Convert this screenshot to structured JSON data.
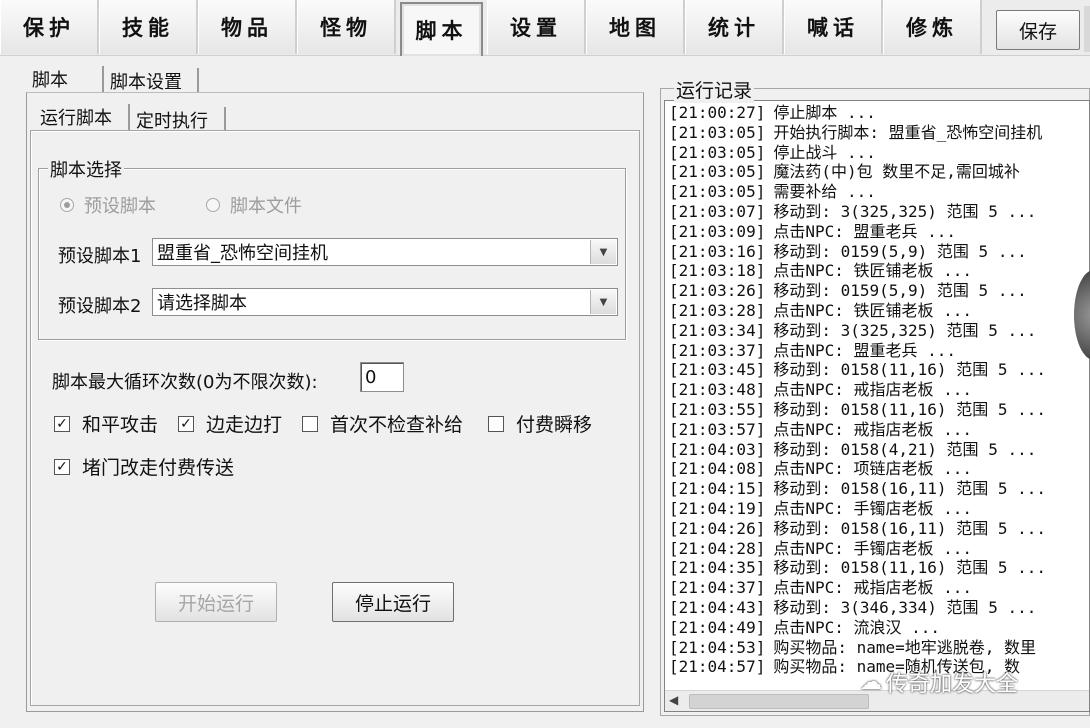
{
  "top_tabs": [
    {
      "label": "保护",
      "active": false
    },
    {
      "label": "技能",
      "active": false
    },
    {
      "label": "物品",
      "active": false
    },
    {
      "label": "怪物",
      "active": false
    },
    {
      "label": "脚本",
      "active": true
    },
    {
      "label": "设置",
      "active": false
    },
    {
      "label": "地图",
      "active": false
    },
    {
      "label": "统计",
      "active": false
    },
    {
      "label": "喊话",
      "active": false
    },
    {
      "label": "修炼",
      "active": false
    }
  ],
  "save_label": "保存",
  "sub_tabs": {
    "tab1": "脚本",
    "tab2": "脚本设置"
  },
  "inner_tabs": {
    "tab1": "运行脚本",
    "tab2": "定时执行"
  },
  "script_select": {
    "group_title": "脚本选择",
    "radio_preset": "预设脚本",
    "radio_file": "脚本文件",
    "preset1_label": "预设脚本1",
    "preset1_value": "盟重省_恐怖空间挂机",
    "preset2_label": "预设脚本2",
    "preset2_value": "请选择脚本"
  },
  "max_loop": {
    "label": "脚本最大循环次数(0为不限次数):",
    "value": "0"
  },
  "options": {
    "peace_attack": "和平攻击",
    "walk_and_fight": "边走边打",
    "skip_first_check": "首次不检查补给",
    "paid_teleport": "付费瞬移",
    "door_paid_transfer": "堵门改走付费传送"
  },
  "buttons": {
    "start": "开始运行",
    "stop": "停止运行"
  },
  "log": {
    "title": "运行记录",
    "lines": [
      {
        "time": "[21:00:27]",
        "msg": "停止脚本 ..."
      },
      {
        "time": "[21:03:05]",
        "msg": "开始执行脚本: 盟重省_恐怖空间挂机"
      },
      {
        "time": "[21:03:05]",
        "msg": "停止战斗 ..."
      },
      {
        "time": "[21:03:05]",
        "msg": "魔法药(中)包 数里不足,需回城补"
      },
      {
        "time": "[21:03:05]",
        "msg": "需要补给 ..."
      },
      {
        "time": "[21:03:07]",
        "msg": "移动到: 3(325,325) 范围 5 ..."
      },
      {
        "time": "[21:03:09]",
        "msg": "点击NPC: 盟重老兵 ..."
      },
      {
        "time": "[21:03:16]",
        "msg": "移动到: 0159(5,9) 范围 5 ..."
      },
      {
        "time": "[21:03:18]",
        "msg": "点击NPC: 铁匠铺老板 ..."
      },
      {
        "time": "[21:03:26]",
        "msg": "移动到: 0159(5,9) 范围 5 ..."
      },
      {
        "time": "[21:03:28]",
        "msg": "点击NPC: 铁匠铺老板 ..."
      },
      {
        "time": "[21:03:34]",
        "msg": "移动到: 3(325,325) 范围 5 ..."
      },
      {
        "time": "[21:03:37]",
        "msg": "点击NPC: 盟重老兵 ..."
      },
      {
        "time": "[21:03:45]",
        "msg": "移动到: 0158(11,16) 范围 5 ..."
      },
      {
        "time": "[21:03:48]",
        "msg": "点击NPC: 戒指店老板 ..."
      },
      {
        "time": "[21:03:55]",
        "msg": "移动到: 0158(11,16) 范围 5 ..."
      },
      {
        "time": "[21:03:57]",
        "msg": "点击NPC: 戒指店老板 ..."
      },
      {
        "time": "[21:04:03]",
        "msg": "移动到: 0158(4,21) 范围 5 ..."
      },
      {
        "time": "[21:04:08]",
        "msg": "点击NPC: 项链店老板 ..."
      },
      {
        "time": "[21:04:15]",
        "msg": "移动到: 0158(16,11) 范围 5 ..."
      },
      {
        "time": "[21:04:19]",
        "msg": "点击NPC: 手镯店老板 ..."
      },
      {
        "time": "[21:04:26]",
        "msg": "移动到: 0158(16,11) 范围 5 ..."
      },
      {
        "time": "[21:04:28]",
        "msg": "点击NPC: 手镯店老板 ..."
      },
      {
        "time": "[21:04:35]",
        "msg": "移动到: 0158(11,16) 范围 5 ..."
      },
      {
        "time": "[21:04:37]",
        "msg": "点击NPC: 戒指店老板 ..."
      },
      {
        "time": "[21:04:43]",
        "msg": "移动到: 3(346,334) 范围 5 ..."
      },
      {
        "time": "[21:04:49]",
        "msg": "点击NPC: 流浪汉 ..."
      },
      {
        "time": "[21:04:53]",
        "msg": "购买物品: name=地牢逃脱卷, 数里"
      },
      {
        "time": "[21:04:57]",
        "msg": "购买物品: name=随机传送包, 数"
      }
    ]
  },
  "watermark": "传奇加发大全"
}
